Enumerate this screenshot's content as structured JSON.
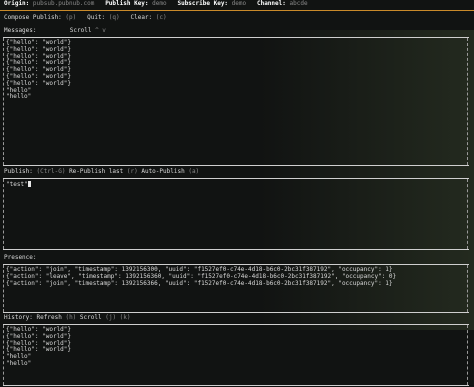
{
  "header": {
    "origin_label": "Origin:",
    "origin_value": "pubsub.pubnub.com",
    "publish_key_label": "Publish Key:",
    "publish_key_value": "demo",
    "subscribe_key_label": "Subscribe Key:",
    "subscribe_key_value": "demo",
    "channel_label": "Channel:",
    "channel_value": "abcde"
  },
  "menu": {
    "compose_label": "Compose Publish:",
    "compose_key": "(p)",
    "quit_label": "Quit:",
    "quit_key": "(q)",
    "clear_label": "Clear:",
    "clear_key": "(c)"
  },
  "messages": {
    "label": "Messages:",
    "scroll_label": "Scroll",
    "scroll_keys": "^ v",
    "lines": [
      "{\"hello\": \"world\"}",
      "{\"hello\": \"world\"}",
      "{\"hello\": \"world\"}",
      "{\"hello\": \"world\"}",
      "{\"hello\": \"world\"}",
      "{\"hello\": \"world\"}",
      "{\"hello\": \"world\"}",
      "\"hello\"",
      "\"hello\""
    ]
  },
  "publish": {
    "label": "Publish:",
    "key": "(Ctrl-G)",
    "republish_label": "Re-Publish last",
    "republish_key": "(r)",
    "auto_label": "Auto-Publish",
    "auto_key": "(a)",
    "input_value": "\"test\""
  },
  "presence": {
    "label": "Presence:",
    "lines": [
      "{\"action\": \"join\", \"timestamp\": 1392156300, \"uuid\": \"f1527ef0-c74e-4d18-b6c0-2bc31f387192\", \"occupancy\": 1}",
      "{\"action\": \"leave\", \"timestamp\": 1392156360, \"uuid\": \"f1527ef0-c74e-4d18-b6c0-2bc31f387192\", \"occupancy\": 0}",
      "{\"action\": \"join\", \"timestamp\": 1392156366, \"uuid\": \"f1527ef0-c74e-4d18-b6c0-2bc31f387192\", \"occupancy\": 1}"
    ]
  },
  "history": {
    "label": "History:",
    "refresh_label": "Refresh",
    "refresh_key": "(h)",
    "scroll_label": "Scroll",
    "scroll_keys": "(j) (k)",
    "lines": [
      "{\"hello\": \"world\"}",
      "{\"hello\": \"world\"}",
      "{\"hello\": \"world\"}",
      "{\"hello\": \"world\"}",
      "\"hello\"",
      "\"hello\""
    ]
  }
}
